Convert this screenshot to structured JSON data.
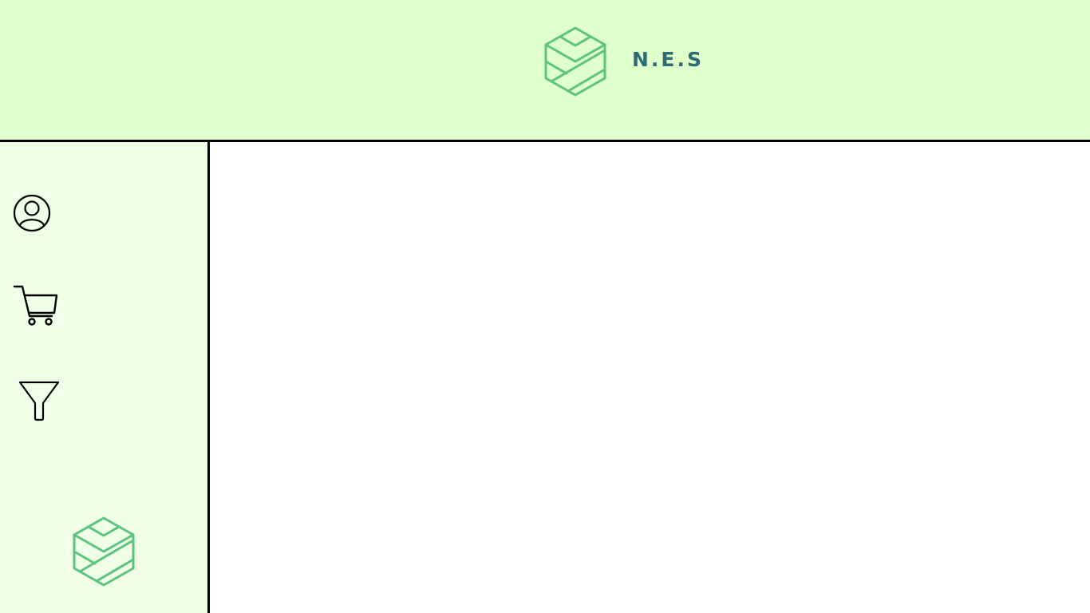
{
  "header": {
    "brand_name": "N.E.S",
    "logo_icon": "hexagon-logo-icon"
  },
  "sidebar": {
    "items": [
      {
        "icon": "user-profile-icon"
      },
      {
        "icon": "shopping-cart-icon"
      },
      {
        "icon": "filter-funnel-icon"
      }
    ],
    "footer_logo_icon": "hexagon-logo-icon"
  },
  "colors": {
    "header_bg": "#dfffcb",
    "sidebar_bg": "#f0ffe8",
    "logo_green": "#5cc47c",
    "brand_text": "#2f6b73",
    "border": "#000000"
  }
}
